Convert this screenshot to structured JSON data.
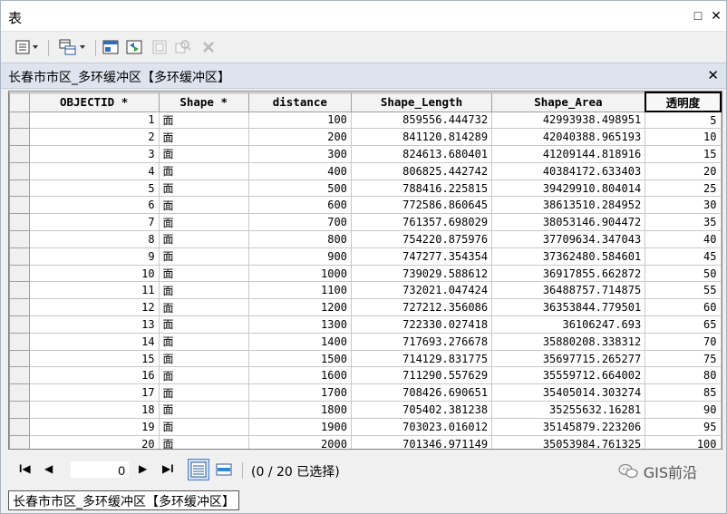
{
  "window": {
    "title": "表",
    "maximize_glyph": "□",
    "close_glyph": "✕"
  },
  "toolbar": {
    "items": [
      {
        "name": "table-options-icon",
        "enabled": true
      },
      {
        "name": "related-tables-icon",
        "enabled": true
      },
      {
        "name": "select-by-attributes-icon",
        "enabled": true
      },
      {
        "name": "switch-selection-icon",
        "enabled": true
      },
      {
        "name": "clear-selection-icon",
        "enabled": false
      },
      {
        "name": "zoom-to-selected-icon",
        "enabled": false
      },
      {
        "name": "delete-selected-icon",
        "enabled": false
      }
    ]
  },
  "tab": {
    "title": "长春市市区_多环缓冲区【多环缓冲区】",
    "close_glyph": "✕"
  },
  "table": {
    "columns": [
      "OBJECTID *",
      "Shape *",
      "distance",
      "Shape_Length",
      "Shape_Area",
      "透明度"
    ],
    "rows": [
      [
        "1",
        "面",
        "100",
        "859556.444732",
        "42993938.498951",
        "5"
      ],
      [
        "2",
        "面",
        "200",
        "841120.814289",
        "42040388.965193",
        "10"
      ],
      [
        "3",
        "面",
        "300",
        "824613.680401",
        "41209144.818916",
        "15"
      ],
      [
        "4",
        "面",
        "400",
        "806825.442742",
        "40384172.633403",
        "20"
      ],
      [
        "5",
        "面",
        "500",
        "788416.225815",
        "39429910.804014",
        "25"
      ],
      [
        "6",
        "面",
        "600",
        "772586.860645",
        "38613510.284952",
        "30"
      ],
      [
        "7",
        "面",
        "700",
        "761357.698029",
        "38053146.904472",
        "35"
      ],
      [
        "8",
        "面",
        "800",
        "754220.875976",
        "37709634.347043",
        "40"
      ],
      [
        "9",
        "面",
        "900",
        "747277.354354",
        "37362480.584601",
        "45"
      ],
      [
        "10",
        "面",
        "1000",
        "739029.588612",
        "36917855.662872",
        "50"
      ],
      [
        "11",
        "面",
        "1100",
        "732021.047424",
        "36488757.714875",
        "55"
      ],
      [
        "12",
        "面",
        "1200",
        "727212.356086",
        "36353844.779501",
        "60"
      ],
      [
        "13",
        "面",
        "1300",
        "722330.027418",
        "36106247.693",
        "65"
      ],
      [
        "14",
        "面",
        "1400",
        "717693.276678",
        "35880208.338312",
        "70"
      ],
      [
        "15",
        "面",
        "1500",
        "714129.831775",
        "35697715.265277",
        "75"
      ],
      [
        "16",
        "面",
        "1600",
        "711290.557629",
        "35559712.664002",
        "80"
      ],
      [
        "17",
        "面",
        "1700",
        "708426.690651",
        "35405014.303274",
        "85"
      ],
      [
        "18",
        "面",
        "1800",
        "705402.381238",
        "35255632.16281",
        "90"
      ],
      [
        "19",
        "面",
        "1900",
        "703023.016012",
        "35145879.223206",
        "95"
      ],
      [
        "20",
        "面",
        "2000",
        "701346.971149",
        "35053984.761325",
        "100"
      ]
    ]
  },
  "navigation": {
    "first": "I◀",
    "prev": "◀",
    "record": "0",
    "next": "▶",
    "last": "▶I",
    "selection_status": "(0 / 20 已选择)"
  },
  "watermark": "GIS前沿",
  "bottom_tab": "长春市市区_多环缓冲区【多环缓冲区】"
}
